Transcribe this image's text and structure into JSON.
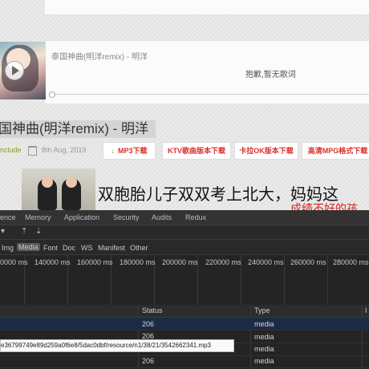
{
  "player": {
    "title": "泰国神曲(明洋remix) - 明洋",
    "lyric_status": "抱歉,暂无歌词"
  },
  "post": {
    "title": "国神曲(明洋remix) - 明洋",
    "category": "nclude",
    "date": "8th Aug, 2019",
    "buttons": {
      "mp3": "MP3下载",
      "ktv": "KTV歌曲版本下载",
      "karaoke": "卡拉OK版本下载",
      "mpg": "高清MPG格式下载"
    }
  },
  "news": {
    "title": "双胞胎儿子双双考上北大，妈妈这",
    "subtitle": "成绩不好的孩"
  },
  "devtools": {
    "tabs": [
      "ence",
      "Memory",
      "Application",
      "Security",
      "Audits",
      "Redux"
    ],
    "filters": [
      "Img",
      "Media",
      "Font",
      "Doc",
      "WS",
      "Manifest",
      "Other"
    ],
    "active_filter": "Media",
    "timeline_labels": [
      "0000 ms",
      "140000 ms",
      "160000 ms",
      "180000 ms",
      "200000 ms",
      "220000 ms",
      "240000 ms",
      "260000 ms",
      "280000 ms"
    ],
    "columns": [
      "Status",
      "Type",
      "I"
    ],
    "rows": [
      {
        "status": "206",
        "type": "media"
      },
      {
        "status": "206",
        "type": "media"
      },
      {
        "status": "206",
        "type": "media"
      },
      {
        "status": "206",
        "type": "media"
      },
      {
        "status": "206",
        "type": "media"
      }
    ],
    "tooltip": "e36799749e89d259a0f6e8/5dac0dbf/resource/n1/38/21/3542662341.mp3"
  },
  "colors": {
    "accent_red": "#d9302c",
    "devtools_bg": "#242424",
    "selected_row": "#1c2a44"
  },
  "icons": {
    "mp3_button": "download-arrow-icon",
    "date": "calendar-icon",
    "player": "play-icon"
  }
}
